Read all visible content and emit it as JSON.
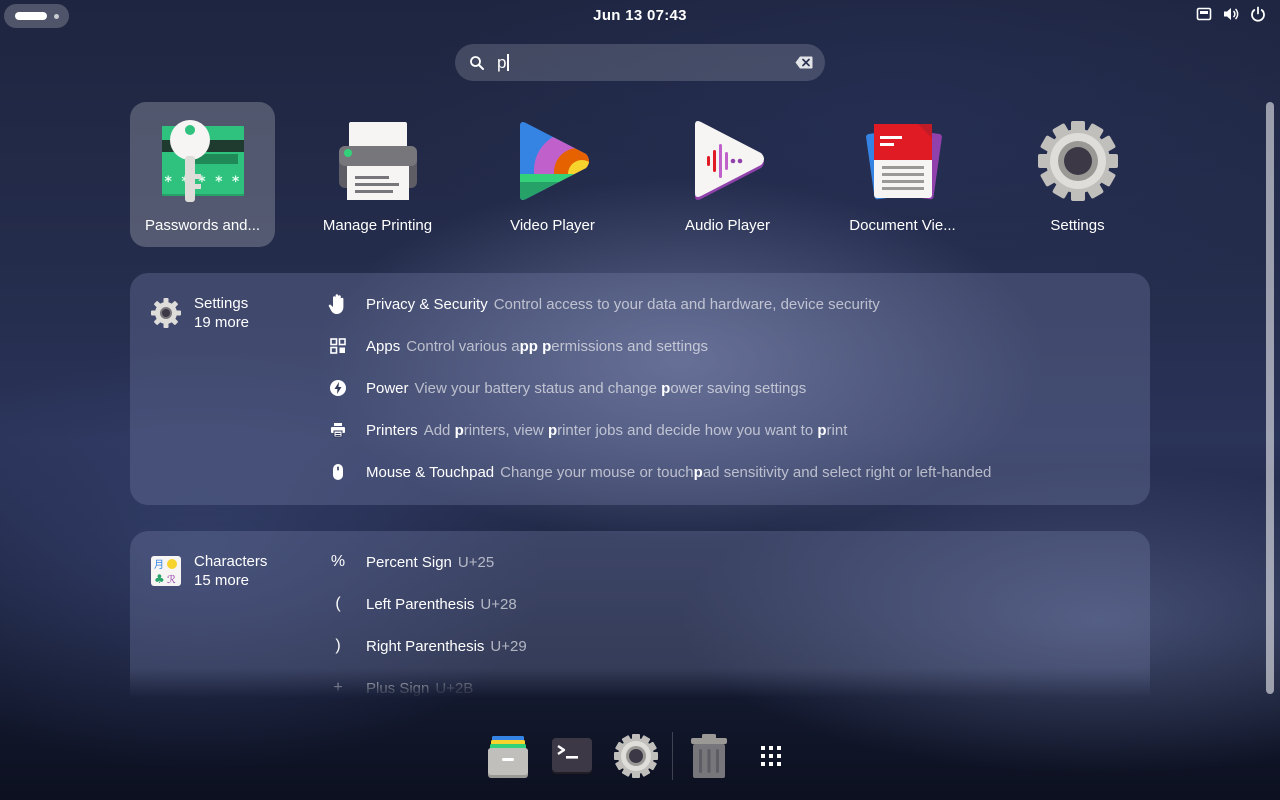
{
  "topbar": {
    "clock": "Jun 13  07:43",
    "tray_icons": [
      "network-icon",
      "volume-icon",
      "power-icon"
    ]
  },
  "search": {
    "query": "p"
  },
  "apps": [
    {
      "label": "Passwords and...",
      "icon": "passwords-app-icon",
      "selected": true
    },
    {
      "label": "Manage Printing",
      "icon": "printer-app-icon"
    },
    {
      "label": "Video Player",
      "icon": "video-player-app-icon"
    },
    {
      "label": "Audio Player",
      "icon": "audio-player-app-icon"
    },
    {
      "label": "Document Vie...",
      "icon": "document-viewer-app-icon"
    },
    {
      "label": "Settings",
      "icon": "settings-app-icon"
    }
  ],
  "settings_provider": {
    "name": "Settings",
    "more": "19 more",
    "results": [
      {
        "title": "Privacy & Security",
        "desc": "Control access to your data and hardware, device security",
        "icon": "hand-icon"
      },
      {
        "title": "Apps",
        "desc": "Control various app permissions and settings",
        "icon": "apps-grid-icon"
      },
      {
        "title": "Power",
        "desc": "View your battery status and change power saving settings",
        "icon": "power-bolt-icon"
      },
      {
        "title": "Printers",
        "desc": "Add printers, view printer jobs and decide how you want to print",
        "icon": "printer-icon"
      },
      {
        "title": "Mouse & Touchpad",
        "desc": "Change your mouse or touchpad sensitivity and select right or left-handed",
        "icon": "mouse-icon"
      }
    ]
  },
  "characters_provider": {
    "name": "Characters",
    "more": "15 more",
    "results": [
      {
        "glyph": "%",
        "title": "Percent Sign",
        "desc": "U+25"
      },
      {
        "glyph": "(",
        "title": "Left Parenthesis",
        "desc": "U+28"
      },
      {
        "glyph": ")",
        "title": "Right Parenthesis",
        "desc": "U+29"
      },
      {
        "glyph": "+",
        "title": "Plus Sign",
        "desc": "U+2B"
      }
    ]
  },
  "dock": [
    "files-icon",
    "terminal-icon",
    "settings-icon",
    "trash-icon",
    "show-apps-icon"
  ],
  "colors": {
    "accent": "#3584e4",
    "panel_bg": "rgba(120,130,170,0.32)"
  }
}
